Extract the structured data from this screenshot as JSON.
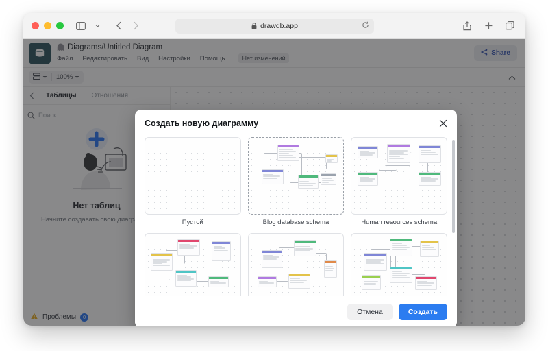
{
  "browser": {
    "url": "drawdb.app",
    "lock_icon": "lock-icon",
    "reload_icon": "reload-icon",
    "sidebar_toggle_icon": "sidebar-toggle-icon",
    "chevron_down_icon": "chevron-down-icon",
    "back_icon": "back-arrow-icon",
    "forward_icon": "forward-arrow-icon",
    "share_icon": "share-upload-icon",
    "new_tab_icon": "plus-icon",
    "tabs_icon": "tab-overview-icon"
  },
  "app": {
    "logo_icon": "database-logo-icon",
    "ghost_icon": "ghost-icon",
    "doc_title": "Diagrams/Untitled Diagram",
    "menu": [
      {
        "label": "Файл"
      },
      {
        "label": "Редактировать"
      },
      {
        "label": "Вид"
      },
      {
        "label": "Настройки"
      },
      {
        "label": "Помощь"
      }
    ],
    "save_state": "Нет изменений",
    "share_label": "Share",
    "share_icon": "share-nodes-icon",
    "toolbar": {
      "layout_icon": "layout-rows-icon",
      "layout_caret_icon": "caret-down-icon",
      "zoom_level": "100%",
      "zoom_caret_icon": "caret-down-icon",
      "collapse_icon": "chevron-up-icon"
    },
    "sidebar": {
      "back_icon": "chevron-left-icon",
      "tabs": [
        {
          "label": "Таблицы",
          "active": true
        },
        {
          "label": "Отношения",
          "active": false
        }
      ],
      "search_icon": "search-icon",
      "search_placeholder": "Поиск...",
      "search_caret_icon": "chevron-down-icon",
      "add_icon": "plus-icon",
      "add_label": "",
      "empty_title": "Нет таблиц",
      "empty_sub": "Начните создавать свою диаграмму!",
      "empty_illustration_icon": "person-with-laptop-illustration",
      "empty_plus_icon": "plus-icon"
    },
    "issues": {
      "warning_icon": "warning-triangle-icon",
      "label": "Проблемы",
      "count": "0",
      "chevron_icon": "chevron-down-icon"
    }
  },
  "modal": {
    "title": "Создать новую диаграмму",
    "close_icon": "close-icon",
    "templates": [
      {
        "label": "Пустой",
        "selected": false,
        "kind": "blank"
      },
      {
        "label": "Blog database schema",
        "selected": true,
        "kind": "blog"
      },
      {
        "label": "Human resources schema",
        "selected": false,
        "kind": "hr"
      },
      {
        "label": "",
        "selected": false,
        "kind": "row2a"
      },
      {
        "label": "",
        "selected": false,
        "kind": "row2b"
      },
      {
        "label": "",
        "selected": false,
        "kind": "row2c"
      }
    ],
    "cancel_label": "Отмена",
    "create_label": "Создать"
  },
  "colors": {
    "accent": "#2b7cf0",
    "link": "#1b6ef3",
    "logo_bg": "#1f4b55",
    "overlay": "rgba(40,40,42,0.55)"
  }
}
